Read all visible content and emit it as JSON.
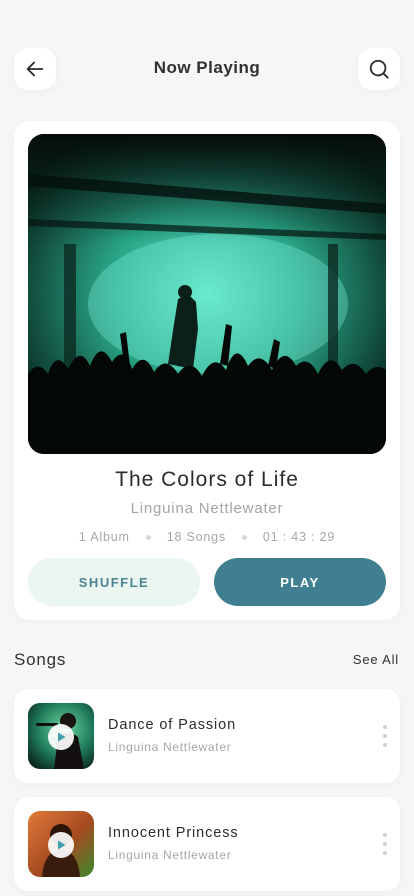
{
  "header": {
    "title": "Now Playing",
    "back_icon": "arrow-left-icon",
    "search_icon": "search-icon"
  },
  "album": {
    "title": "The Colors of Life",
    "artist": "Linguina Nettlewater",
    "meta": {
      "albums": "1 Album",
      "songs": "18 Songs",
      "duration": "01 : 43 : 29"
    },
    "shuffle_label": "SHUFFLE",
    "play_label": "PLAY"
  },
  "songs_section": {
    "heading": "Songs",
    "see_all_label": "See All",
    "items": [
      {
        "title": "Dance of Passion",
        "artist": "Linguina Nettlewater"
      },
      {
        "title": "Innocent Princess",
        "artist": "Linguina Nettlewater"
      }
    ]
  },
  "colors": {
    "accent": "#3f7f91",
    "accent_light": "#eaf6ef",
    "background": "#f6f6f7"
  }
}
